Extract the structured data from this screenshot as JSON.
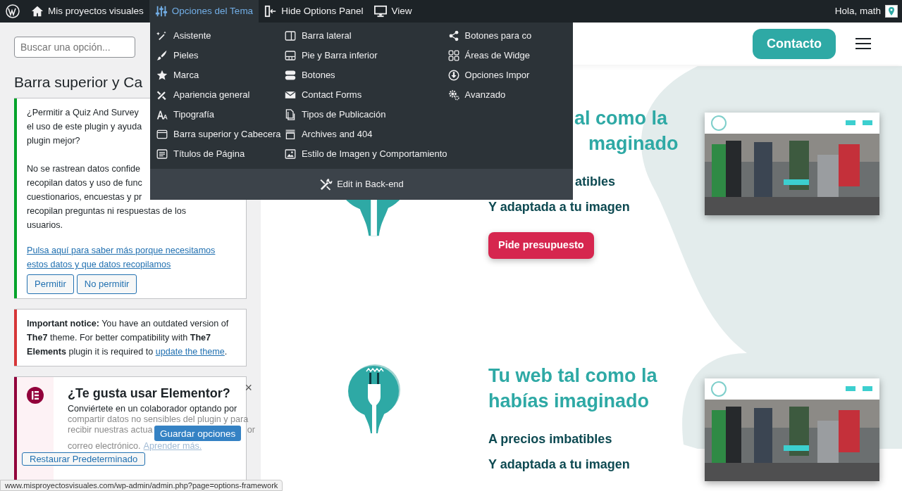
{
  "admin_bar": {
    "items": [
      {
        "label": "Mis proyectos visuales",
        "selected": false
      },
      {
        "label": "Opciones del Tema",
        "selected": true
      },
      {
        "label": "Hide Options Panel",
        "selected": false
      },
      {
        "label": "View",
        "selected": false
      }
    ],
    "greeting": "Hola, math"
  },
  "theme_menu": {
    "columns": [
      [
        "Asistente",
        "Pieles",
        "Marca",
        "Apariencia general",
        "Tipografía",
        "Barra superior y Cabecera",
        "Títulos de Página"
      ],
      [
        "Barra lateral",
        "Pie y Barra inferior",
        "Botones",
        "Contact Forms",
        "Tipos de Publicación",
        "Archives and 404",
        "Estilo de Imagen y Comportamiento"
      ],
      [
        "Botones para co",
        "Áreas de Widge",
        "Opciones Impor",
        "Avanzado"
      ]
    ],
    "footer": "Edit in Back-end"
  },
  "options_panel": {
    "search": {
      "placeholder": "Buscar una opción..."
    },
    "heading": "Barra superior y Ca",
    "notices": [
      {
        "kind": "consent",
        "color": "#00a32a",
        "lines": [
          "¿Permitir a Quiz And Survey",
          "el uso de este plugin y ayuda",
          "plugin mejor?"
        ],
        "lines2": [
          "No se rastrean datos confide",
          "recopilan datos y uso de func",
          "cuestionarios, encuestas y pr",
          "recopilan preguntas ni respuestas de los",
          "usuarios."
        ],
        "link": "Pulsa aquí para saber más porque necesitamos estos datos y que datos recopilamos",
        "buttons": [
          "Permitir",
          "No permitir"
        ]
      },
      {
        "kind": "warning",
        "color": "#d63638",
        "text": "**Important notice:** You have an outdated version of **The7** theme. For better compatibility with **The7 Elements** plugin it is required to",
        "link": "update the theme",
        "after": "."
      },
      {
        "kind": "promo",
        "color": "#92003b",
        "title": "¿Te gusta usar Elementor?",
        "close": "×",
        "lines": [
          "Conviértete en un colaborador optando por",
          "compartir datos no sensibles del plugin y para",
          "recibir nuestras actua",
          "correo electrónico."
        ],
        "tail": "or",
        "link": "Aprender más."
      }
    ]
  },
  "save_bar": {
    "save": "Guardar opciones",
    "reset": "Restaurar Predeterminado"
  },
  "status_url": "www.misproyectosvisuales.com/wp-admin/admin.php?page=options-framework",
  "site": {
    "contact": "Contacto",
    "hero": [
      {
        "title": [
          "al como la",
          "maginado"
        ],
        "lines": [
          "atibles",
          "Y adaptada a tu imagen"
        ],
        "button": "Pide presupuesto"
      },
      {
        "title": [
          "Tu web tal como la",
          "habías imaginado"
        ],
        "lines": [
          "A precios imbatibles",
          "Y adaptada a tu imagen"
        ]
      }
    ]
  }
}
